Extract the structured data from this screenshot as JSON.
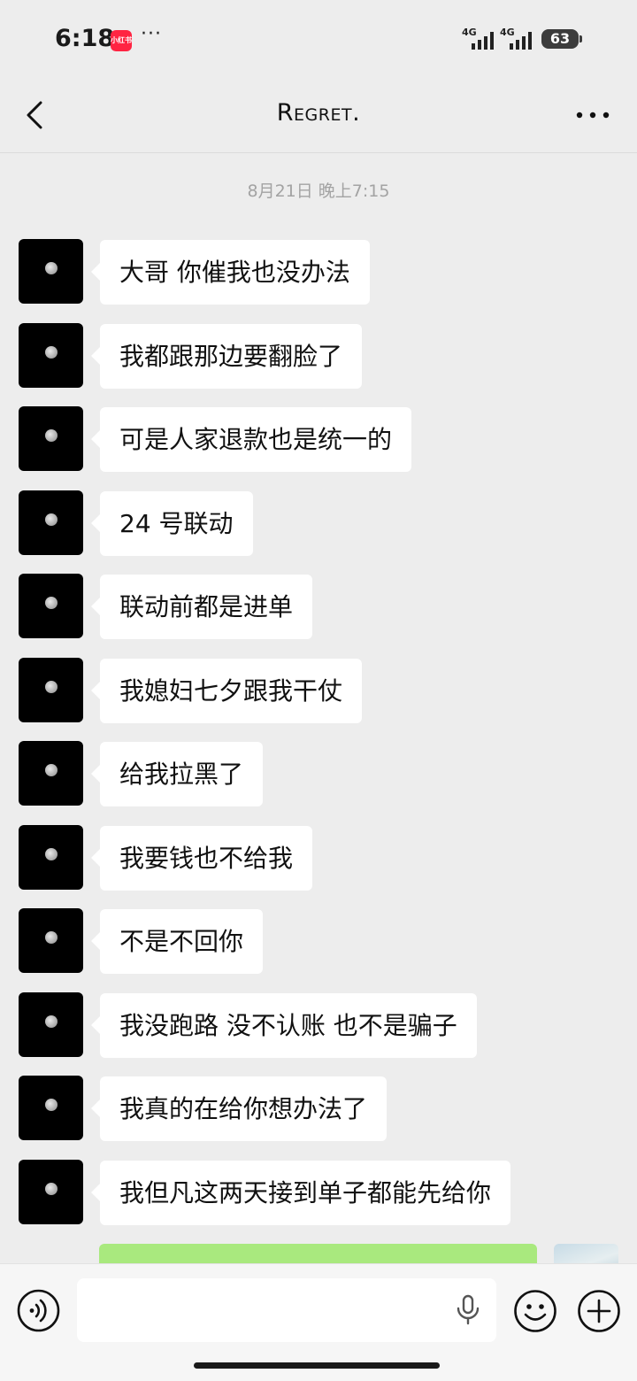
{
  "status_bar": {
    "time": "6:18",
    "app_badge": "小红书",
    "dots": "···",
    "signal_1": "4G",
    "signal_2": "4G",
    "battery": "63"
  },
  "nav": {
    "title": "Regret.",
    "back_icon": "chevron-left-icon",
    "more_icon": "more-dots-icon"
  },
  "timestamp": "8月21日 晚上7:15",
  "messages": [
    {
      "text": "大哥 你催我也没办法"
    },
    {
      "text": "我都跟那边要翻脸了"
    },
    {
      "text": "可是人家退款也是统一的"
    },
    {
      "text": "24 号联动"
    },
    {
      "text": "联动前都是进单"
    },
    {
      "text": "我媳妇七夕跟我干仗"
    },
    {
      "text": "给我拉黑了"
    },
    {
      "text": "我要钱也不给我"
    },
    {
      "text": "不是不回你"
    },
    {
      "text": "我没跑路 没不认账 也不是骗子"
    },
    {
      "text": "我真的在给你想办法了"
    },
    {
      "text": "我但凡这两天接到单子都能先给你"
    }
  ],
  "input_bar": {
    "placeholder": "",
    "voice_icon": "voice-icon",
    "mic_icon": "microphone-icon",
    "emoji_icon": "emoji-icon",
    "add_icon": "plus-circle-icon"
  },
  "colors": {
    "background": "#ededed",
    "bubble_incoming": "#ffffff",
    "bubble_outgoing": "#a9e97e",
    "battery": "#3c3c3c",
    "badge": "#ff2442"
  }
}
